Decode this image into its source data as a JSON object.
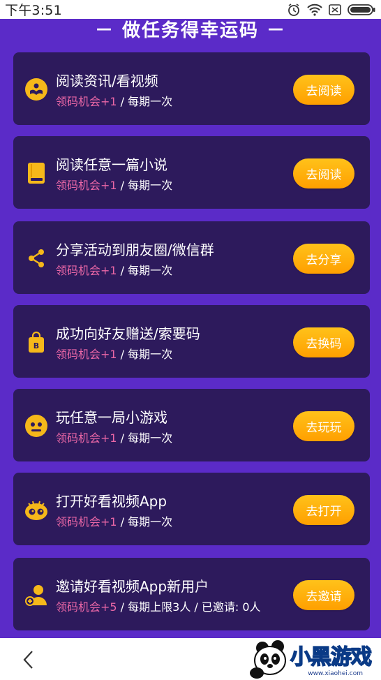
{
  "status_bar": {
    "time": "下午3:51",
    "icons": [
      "alarm-icon",
      "wifi-icon",
      "sim-icon",
      "battery-icon"
    ]
  },
  "section_title": "－ 做任务得幸运码 －",
  "tasks": [
    {
      "icon": "reading-icon",
      "title": "阅读资讯/看视频",
      "reward": "领码机会+1",
      "frequency": " / 每期一次",
      "button": "去阅读"
    },
    {
      "icon": "book-icon",
      "title": "阅读任意一篇小说",
      "reward": "领码机会+1",
      "frequency": " / 每期一次",
      "button": "去阅读"
    },
    {
      "icon": "share-icon",
      "title": "分享活动到朋友圈/微信群",
      "reward": "领码机会+1",
      "frequency": " / 每期一次",
      "button": "去分享"
    },
    {
      "icon": "gift-bag-icon",
      "title": "成功向好友赠送/索要码",
      "reward": "领码机会+1",
      "frequency": " / 每期一次",
      "button": "去换码"
    },
    {
      "icon": "gamepad-icon",
      "title": "玩任意一局小游戏",
      "reward": "领码机会+1",
      "frequency": " / 每期一次",
      "button": "去玩玩"
    },
    {
      "icon": "app-eyes-icon",
      "title": "打开好看视频App",
      "reward": "领码机会+1",
      "frequency": " / 每期一次",
      "button": "去打开"
    },
    {
      "icon": "invite-user-icon",
      "title": "邀请好看视频App新用户",
      "reward": "领码机会+5",
      "frequency": " / 每期上限3人 / 已邀请: 0人",
      "button": "去邀请"
    }
  ],
  "bottom_bar": {
    "back_icon": "chevron-left-icon",
    "watermark_brand": "小黑游戏",
    "watermark_url": "www.xiaohei.com"
  },
  "colors": {
    "background": "#5b2bc8",
    "card": "#2d1a5c",
    "reward_text": "#ea67a6",
    "button": "#ffb000",
    "icon": "#f6b81a"
  }
}
